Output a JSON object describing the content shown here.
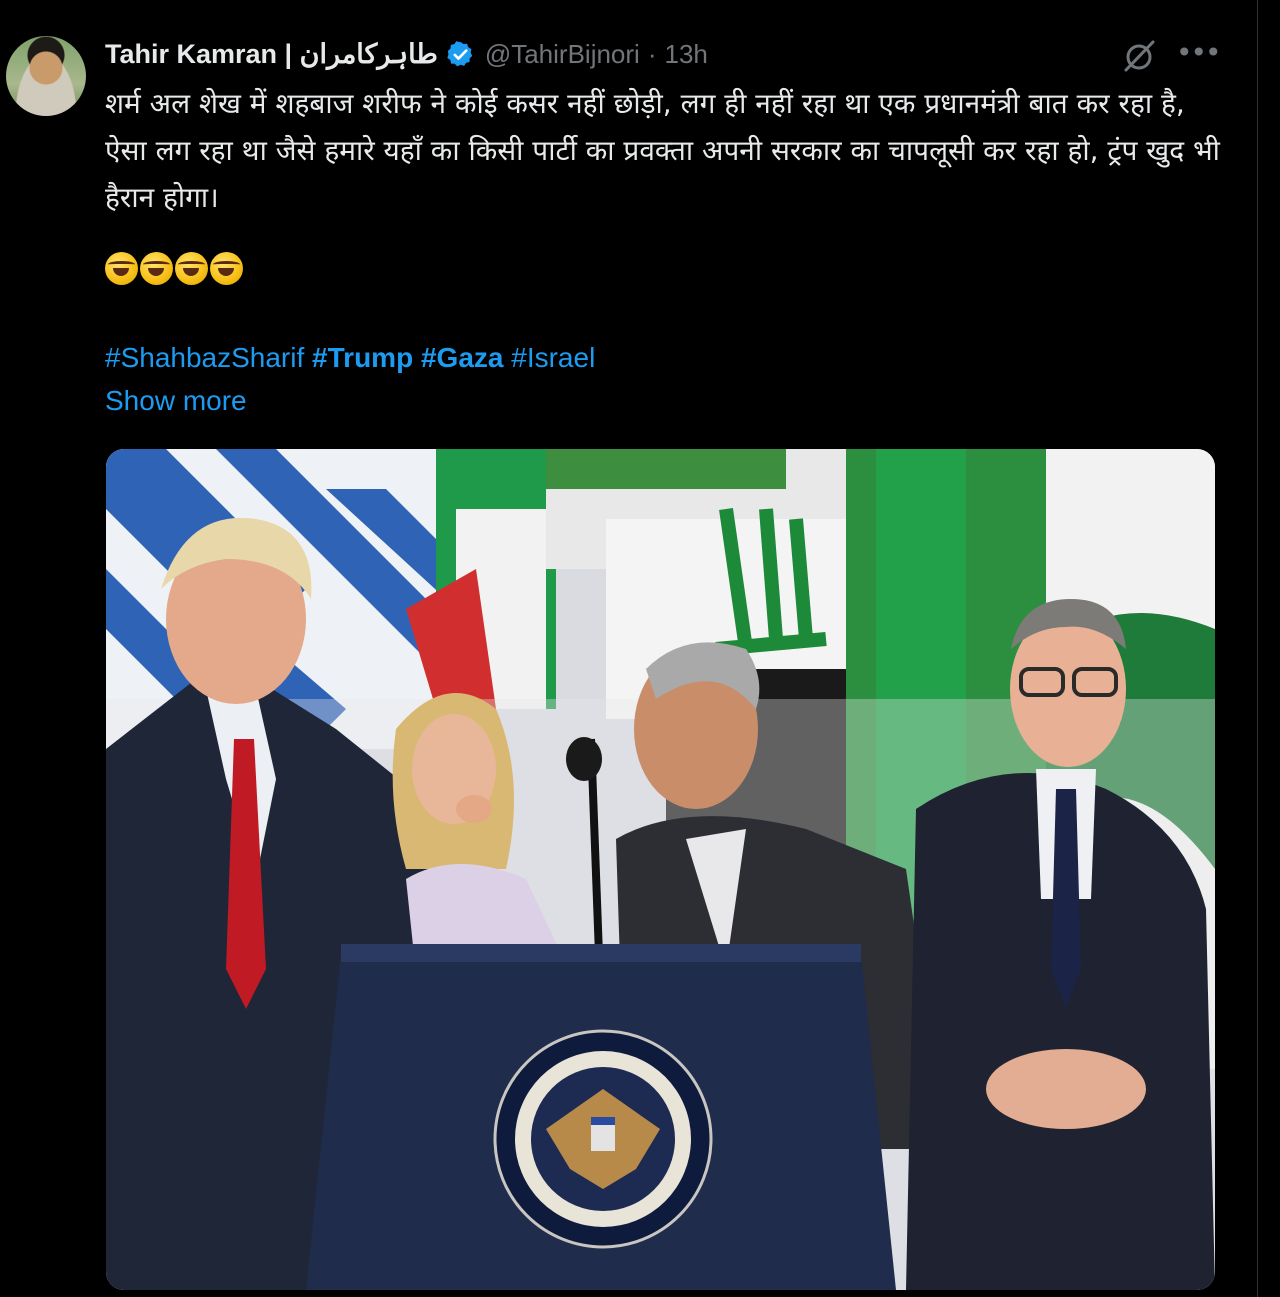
{
  "author": {
    "name": "Tahir Kamran | طاہرکامران",
    "handle": "@TahirBijnori",
    "separator": "·",
    "time": "13h",
    "verified": true
  },
  "tweet": {
    "text": "शर्म अल शेख में शहबाज शरीफ ने कोई कसर नहीं छोड़ी, लग ही नहीं रहा था एक प्रधानमंत्री बात कर रहा है, ऐसा लग रहा था जैसे हमारे यहाँ का किसी पार्टी का प्रवक्ता अपनी सरकार का चापलूसी कर रहा हो, ट्रंप खुद भी हैरान होगा।",
    "emoji_count": 4,
    "emoji_name": "rolling-on-the-floor-laughing",
    "hashtags": [
      {
        "text": "#ShahbazSharif",
        "bold": false
      },
      {
        "text": "#Trump",
        "bold": true
      },
      {
        "text": "#Gaza",
        "bold": true
      },
      {
        "text": "#Israel",
        "bold": false
      }
    ],
    "show_more": "Show more"
  },
  "icons": {
    "verified": "verified-badge-icon",
    "grok": "grok-icon",
    "more": "more-options-icon"
  },
  "colors": {
    "background": "#000000",
    "text": "#e7e9ea",
    "secondary": "#71767b",
    "link": "#1d9bf0"
  }
}
